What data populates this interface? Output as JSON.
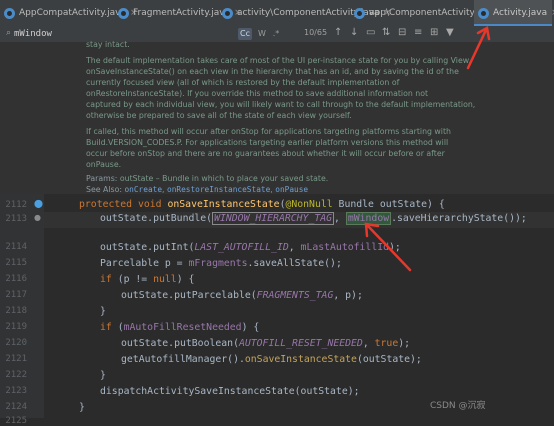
{
  "tabs": [
    {
      "label": "AppCompatActivity.java",
      "active": false
    },
    {
      "label": "FragmentActivity.java",
      "active": false
    },
    {
      "label": "activity\\ComponentActivity.java",
      "active": false
    },
    {
      "label": "app\\ComponentActivity.java",
      "active": false
    },
    {
      "label": "Activity.java",
      "active": true
    }
  ],
  "search": {
    "value": "mWindow",
    "options": [
      "Cc",
      "W",
      ".*"
    ],
    "result_count": "10/65"
  },
  "doc": {
    "line0": "stay intact.",
    "p1": [
      "The default implementation takes care of most of the UI per-instance state for you by calling View.",
      "onSaveInstanceState() on each view in the hierarchy that has an id, and by saving the id of the",
      "currently focused view (all of which is restored by the default implementation of",
      "onRestoreInstanceState). If you override this method to save additional information not",
      "captured by each individual view, you will likely want to call through to the default implementation,",
      "otherwise be prepared to save all of the state of each view yourself."
    ],
    "p2": [
      "If called, this method will occur after onStop for applications targeting platforms starting with",
      "Build.VERSION_CODES.P. For applications targeting earlier platform versions this method will",
      "occur before onStop and there are no guarantees about whether it will occur before or after",
      "onPause."
    ],
    "params_label": "Params:",
    "params_text": "outState – Bundle in which to place your saved state.",
    "see_also_label": "See Also:",
    "see_also_items": [
      "onCreate",
      "onRestoreInstanceState",
      "onPause"
    ]
  },
  "editor": {
    "lines": [
      {
        "num": "2112",
        "text": "protected void onSaveInstanceState(@NonNull Bundle outState) {"
      },
      {
        "num": "2113",
        "text": "outState.putBundle(WINDOW_HIERARCHY_TAG, mWindow.saveHierarchyState());"
      },
      {
        "num": "2114",
        "text": ""
      },
      {
        "num": "2115",
        "text": "outState.putInt(LAST_AUTOFILL_ID, mLastAutofillId);"
      },
      {
        "num": "2116",
        "text": "Parcelable p = mFragments.saveAllState();"
      },
      {
        "num": "2117",
        "text": "if (p != null) {"
      },
      {
        "num": "2118",
        "text": "outState.putParcelable(FRAGMENTS_TAG, p);"
      },
      {
        "num": "2119",
        "text": "}"
      },
      {
        "num": "2120",
        "text": "if (mAutoFillResetNeeded) {"
      },
      {
        "num": "2121",
        "text": "outState.putBoolean(AUTOFILL_RESET_NEEDED, true);"
      },
      {
        "num": "2122",
        "text": "getAutofillManager().onSaveInstanceState(outState);"
      },
      {
        "num": "2123",
        "text": "}"
      },
      {
        "num": "2124",
        "text": "dispatchActivitySaveInstanceState(outState);"
      },
      {
        "num": "2125",
        "text": "}"
      }
    ]
  },
  "watermark": "CSDN @沉寂",
  "colors": {
    "arrow": "#e8372b",
    "accent": "#4a88c7",
    "keyword": "#cc7832",
    "method": "#ffc66d"
  }
}
